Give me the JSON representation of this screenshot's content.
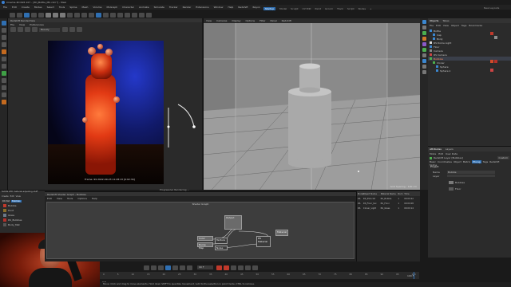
{
  "window": {
    "title": "Cinema 4D R26 107 - [3D_Bottle_MC.c4d *] - Main"
  },
  "menubar": {
    "items": [
      "File",
      "Edit",
      "Create",
      "Modes",
      "Select",
      "Tools",
      "Spline",
      "Mesh",
      "Volume",
      "MoGraph",
      "Character",
      "Animate",
      "Simulate",
      "Tracker",
      "Render",
      "Extensions",
      "Window",
      "Help",
      "Redshift",
      "Rayon"
    ]
  },
  "layout_tabs": [
    "Startup",
    "Model",
    "Sculpt",
    "UV Edit",
    "Paint",
    "Groom",
    "Track",
    "Script",
    "Nodes",
    "+"
  ],
  "new_layouts_label": "New Layouts",
  "render_view": {
    "title": "Redshift RenderView",
    "menu": [
      "File",
      "View",
      "Preferences"
    ],
    "mode_select": "Beauty",
    "overlay_text": "Frame: 99  2022-09-23 11:28:13  [0:02:34]"
  },
  "viewport": {
    "menu": [
      "View",
      "Cameras",
      "Display",
      "Options",
      "Filter",
      "Panel",
      "Redshift"
    ],
    "grid_spacing_label": "Grid Spacing : 100 cm"
  },
  "object_manager": {
    "tabs": [
      "Objects",
      "Takes"
    ],
    "menu": [
      "File",
      "Edit",
      "View",
      "Object",
      "Tags",
      "Bookmarks"
    ],
    "objects": [
      {
        "name": "Bottle",
        "color": "#9ccfff"
      },
      {
        "name": "Cap",
        "color": "#9ccfff"
      },
      {
        "name": "Body",
        "color": "#9ccfff"
      },
      {
        "name": "RS Dome Light",
        "color": "#e0e0e0"
      },
      {
        "name": "Floor",
        "color": "#e0e0e0"
      },
      {
        "name": "Camera",
        "color": "#e0e0e0"
      },
      {
        "name": "RS Camera",
        "color": "#e0e0e0"
      },
      {
        "name": "Bubbles",
        "color": "#ff8a5c"
      },
      {
        "name": "Cloner",
        "color": "#e0e0e0"
      },
      {
        "name": "Sphere",
        "color": "#e0e0e0"
      },
      {
        "name": "Sphere.1",
        "color": "#e0e0e0"
      }
    ]
  },
  "attributes": {
    "tabs": [
      "Attributes",
      "Layers"
    ],
    "menu": [
      "Mode",
      "Edit",
      "User Data"
    ],
    "material_name": "Redshift Layer [Bubbles]",
    "custom_label": "Custom",
    "sub_tabs": [
      "Basic",
      "Coordinates",
      "Object",
      "Matrix",
      "Phong",
      "Tags",
      "Redshift",
      "Spline"
    ],
    "active_sub_tab": "Phong",
    "section_title": "Project",
    "fields": [
      {
        "label": "Name",
        "value": "Bubble"
      },
      {
        "label": "Layer",
        "value": ""
      }
    ],
    "layer_list": [
      {
        "name": "Bubbles",
        "color": "#7a7a7a"
      },
      {
        "name": "Floor",
        "color": "#5a5a5a"
      }
    ]
  },
  "material_manager": {
    "progress_label": "Progressive Rendering ...",
    "header": "Subtle LED material adjusting stuff",
    "menu": [
      "Create",
      "Edit",
      "View",
      "Select",
      "Material",
      "Texture"
    ],
    "chips": [
      "RS Mat",
      "Bubbles",
      "Glass",
      "Floor",
      "Metal"
    ],
    "materials": [
      {
        "name": "Bubble",
        "color": "#c0392b"
      },
      {
        "name": "Dust",
        "color": "#8a6f2a"
      },
      {
        "name": "Glass",
        "color": "#6b7a8a"
      },
      {
        "name": "RS_Bubbles",
        "color": "#b5302a"
      },
      {
        "name": "Body_Mat",
        "color": "#555555"
      }
    ]
  },
  "shader_graph": {
    "title": "Redshift Shader Graph - Bubbles",
    "menu": [
      "Edit",
      "View",
      "Tools",
      "Options",
      "Help"
    ],
    "canvas_label": "Shader Graph",
    "nodes": [
      {
        "label": "Output"
      },
      {
        "label": "Material"
      },
      {
        "label": "RS Material"
      },
      {
        "label": "Color"
      },
      {
        "label": "Bump Map"
      },
      {
        "label": "Texture"
      },
      {
        "label": "Noise"
      }
    ]
  },
  "render_queue": {
    "headers": [
      "Model",
      "Object Name",
      "Material Name",
      "Num",
      "Time"
    ],
    "rows": [
      {
        "model": "RS",
        "name": "RS_SSS.c4d",
        "material": "RS_Bubble",
        "num": "1",
        "time": "00:00:22"
      },
      {
        "model": "RS",
        "name": "RS_Floor_tex",
        "material": "RS_Floor",
        "num": "1",
        "time": "00:00:08"
      },
      {
        "model": "RS",
        "name": "Cloner_Light",
        "material": "RS_Glass",
        "num": "1",
        "time": "00:00:14"
      }
    ]
  },
  "timeline": {
    "current_frame": "99 F",
    "start_frame": "0 F",
    "end_frame": "100 F",
    "ticks": [
      "0",
      "5",
      "10",
      "15",
      "20",
      "25",
      "30",
      "35",
      "40",
      "45",
      "50",
      "55",
      "60",
      "65",
      "70",
      "75",
      "80",
      "85",
      "90",
      "95",
      "100"
    ]
  },
  "status_bar": {
    "text": "Move: Click and drag to move elements. Hold down SHIFT to quantize movement / add to the selection in point mode, CTRL to remove."
  },
  "colors": {
    "accent_blue": "#2f6fb2",
    "bottle_red": "#e23a14",
    "window_bg": "#262626",
    "viewport_bg": "#838383"
  }
}
